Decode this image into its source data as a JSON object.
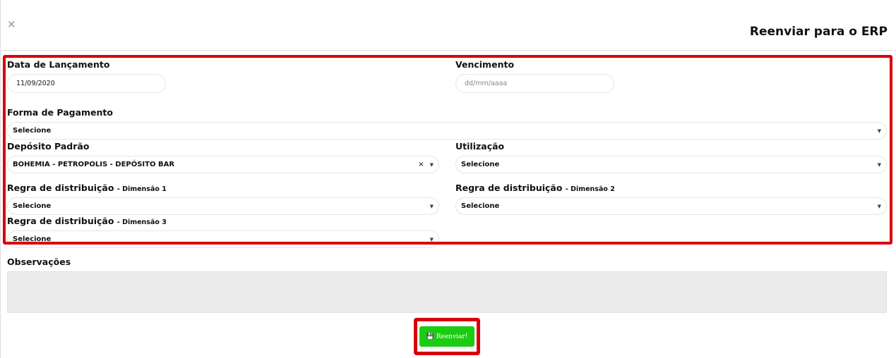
{
  "modal": {
    "title": "Reenviar para o ERP",
    "close_icon": "×"
  },
  "form": {
    "data_lancamento": {
      "label": "Data de Lançamento",
      "value": "11/09/2020"
    },
    "vencimento": {
      "label": "Vencimento",
      "placeholder": "dd/mm/aaaa"
    },
    "forma_pagamento": {
      "label": "Forma de Pagamento",
      "value": "Selecione"
    },
    "deposito": {
      "label": "Depósito Padrão",
      "value": "BOHEMIA - PETROPOLIS - DEPÓSITO BAR",
      "clear": "×"
    },
    "utilizacao": {
      "label": "Utilização",
      "value": "Selecione"
    },
    "regra1": {
      "label": "Regra de distribuição",
      "sub": "- Dimensão 1",
      "value": "Selecione"
    },
    "regra2": {
      "label": "Regra de distribuição",
      "sub": "- Dimensão 2",
      "value": "Selecione"
    },
    "regra3": {
      "label": "Regra de distribuição",
      "sub": "- Dimensão 3",
      "value": "Selecione"
    },
    "observacoes": {
      "label": "Observações",
      "value": ""
    }
  },
  "submit": {
    "label": "Reenviar!",
    "icon": "floppy-disk-icon",
    "color": "#1ccc13"
  },
  "highlight_color": "#d9000b"
}
